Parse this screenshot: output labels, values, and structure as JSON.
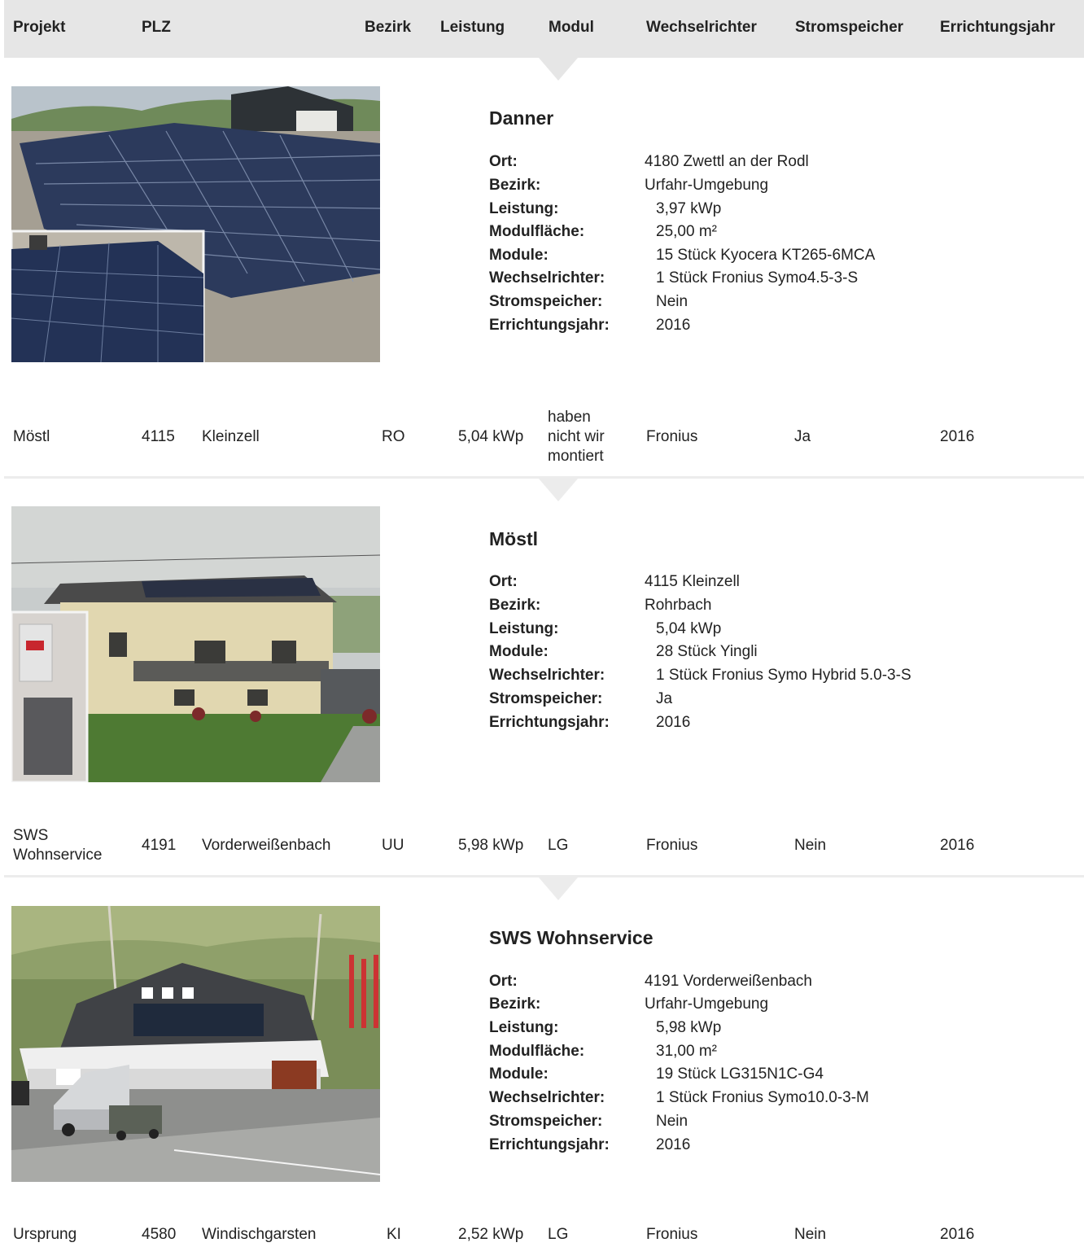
{
  "header": {
    "projekt": "Projekt",
    "plz": "PLZ",
    "bezirk": "Bezirk",
    "leistung": "Leistung",
    "modul": "Modul",
    "wechselrichter": "Wechselrichter",
    "stromspeicher": "Stromspeicher",
    "errichtungsjahr": "Errichtungsjahr"
  },
  "labels": {
    "ort": "Ort:",
    "bezirk": "Bezirk:",
    "leistung": "Leistung:",
    "modulflaeche": "Modulfläche:",
    "module": "Module:",
    "wechselrichter": "Wechselrichter:",
    "stromspeicher": "Stromspeicher:",
    "errichtungsjahr": "Errichtungsjahr:"
  },
  "details": [
    {
      "title": "Danner",
      "ort": "4180 Zwettl an der Rodl",
      "bezirk": "Urfahr-Umgebung",
      "leistung": "3,97 kWp",
      "modulflaeche": "25,00 m²",
      "module": "15 Stück Kyocera KT265-6MCA",
      "wechselrichter": "1 Stück Fronius Symo4.5-3-S",
      "stromspeicher": "Nein",
      "errichtungsjahr": "2016"
    },
    {
      "title": "Möstl",
      "ort": "4115 Kleinzell",
      "bezirk": "Rohrbach",
      "leistung": "5,04 kWp",
      "module": "28 Stück Yingli",
      "wechselrichter": "1 Stück Fronius Symo Hybrid 5.0-3-S",
      "stromspeicher": "Ja",
      "errichtungsjahr": "2016"
    },
    {
      "title": "SWS Wohnservice",
      "ort": "4191 Vorderweißenbach",
      "bezirk": "Urfahr-Umgebung",
      "leistung": "5,98 kWp",
      "modulflaeche": "31,00 m²",
      "module": "19 Stück LG315N1C-G4",
      "wechselrichter": "1 Stück Fronius Symo10.0-3-M",
      "stromspeicher": "Nein",
      "errichtungsjahr": "2016"
    }
  ],
  "rows": [
    {
      "projekt": "Möstl",
      "plz": "4115",
      "ort": "Kleinzell",
      "bezirk": "RO",
      "leistung": "5,04 kWp",
      "modul": "haben nicht wir montiert",
      "wechselrichter": "Fronius",
      "stromspeicher": "Ja",
      "jahr": "2016"
    },
    {
      "projekt": "SWS Wohnservice",
      "plz": "4191",
      "ort": "Vorderweißenbach",
      "bezirk": "UU",
      "leistung": "5,98 kWp",
      "modul": "LG",
      "wechselrichter": "Fronius",
      "stromspeicher": "Nein",
      "jahr": "2016"
    },
    {
      "projekt": "Ursprung",
      "plz": "4580",
      "ort": "Windischgarsten",
      "bezirk": "KI",
      "leistung": "2,52 kWp",
      "modul": "LG",
      "wechselrichter": "Fronius",
      "stromspeicher": "Nein",
      "jahr": "2016"
    }
  ]
}
